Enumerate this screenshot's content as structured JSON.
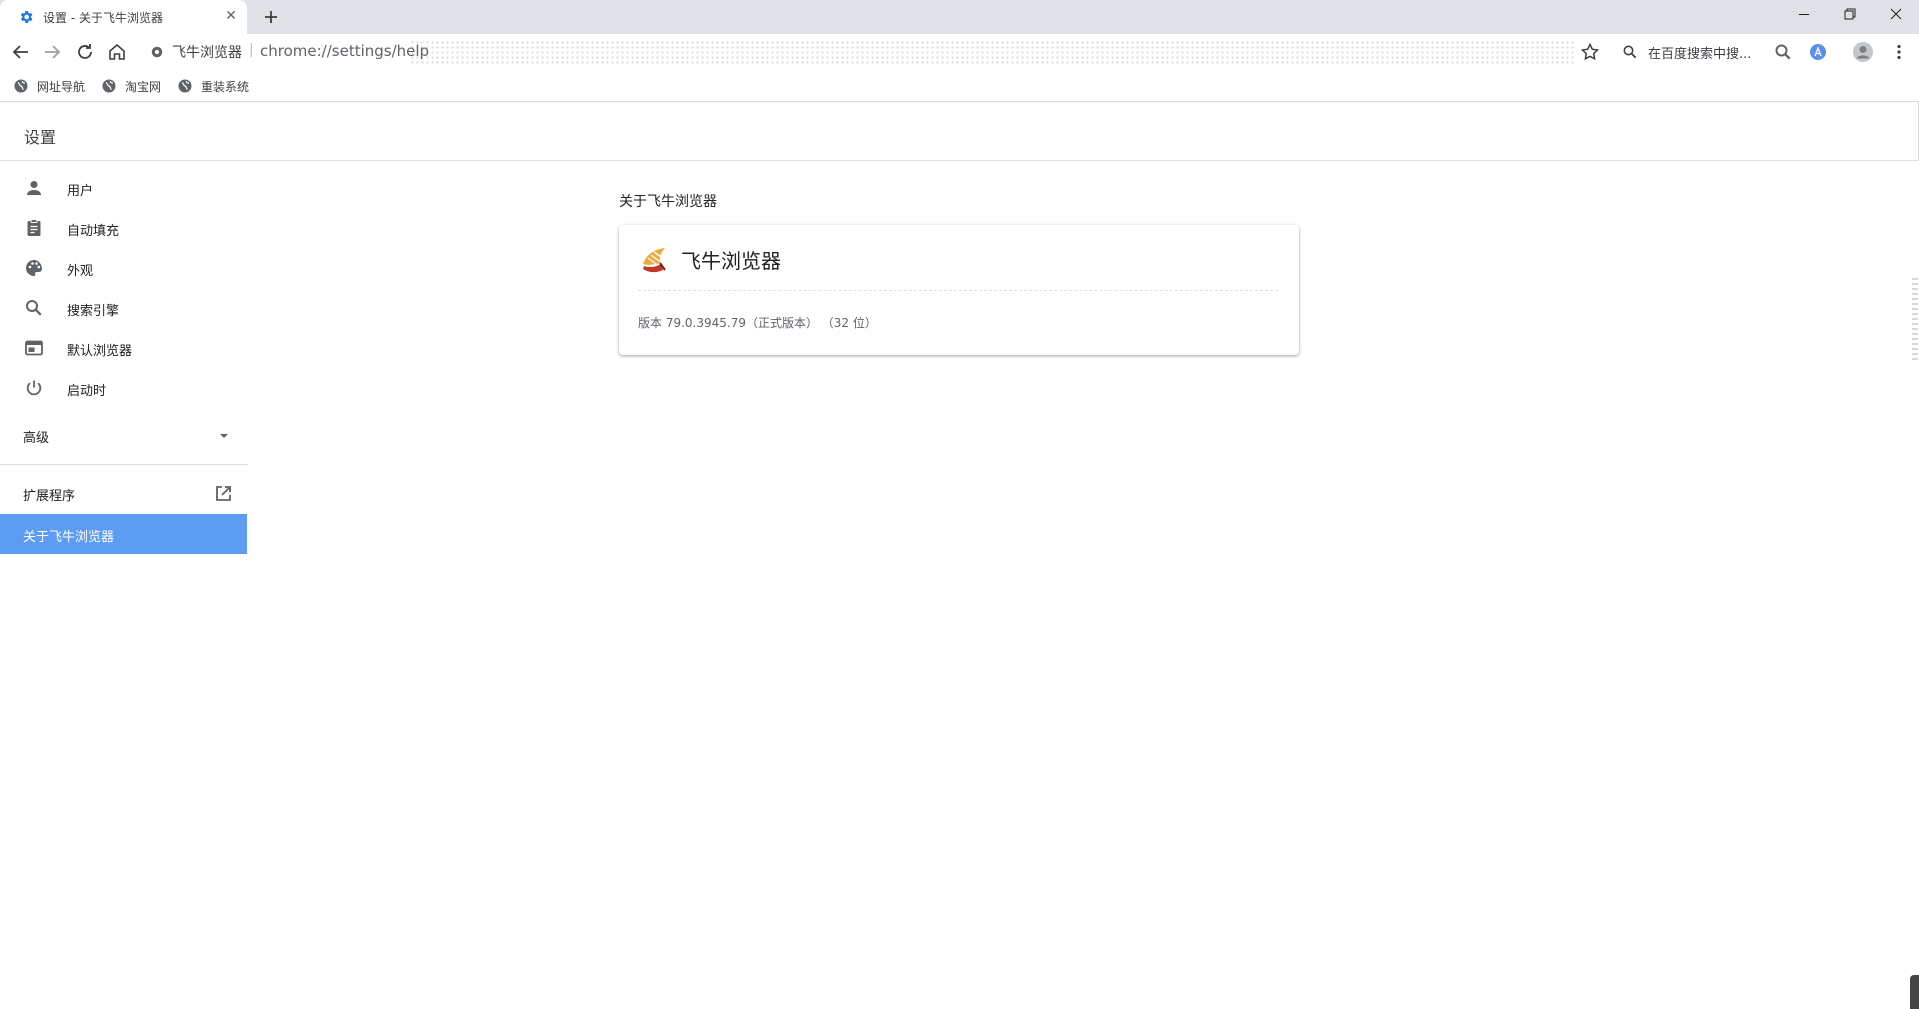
{
  "browser": {
    "tab": {
      "title": "设置 - 关于飞牛浏览器",
      "close": "✕"
    },
    "omnibox": {
      "site_name": "飞牛浏览器",
      "separator": "|",
      "url": "chrome://settings/help"
    },
    "search": {
      "text": "在百度搜索中搜..."
    },
    "bookmarks": [
      {
        "label": "网址导航"
      },
      {
        "label": "淘宝网"
      },
      {
        "label": "重装系统"
      }
    ]
  },
  "settings": {
    "header_title": "设置",
    "nav": [
      {
        "label": "用户",
        "icon": "person-icon"
      },
      {
        "label": "自动填充",
        "icon": "clipboard-icon"
      },
      {
        "label": "外观",
        "icon": "palette-icon"
      },
      {
        "label": "搜索引擎",
        "icon": "search-icon"
      },
      {
        "label": "默认浏览器",
        "icon": "browser-window-icon"
      },
      {
        "label": "启动时",
        "icon": "power-icon"
      }
    ],
    "advanced_label": "高级",
    "extensions_label": "扩展程序",
    "about_label": "关于飞牛浏览器",
    "active_color": "#5c9cf2"
  },
  "about": {
    "section_title": "关于飞牛浏览器",
    "product_name": "飞牛浏览器",
    "version": "版本 79.0.3945.79（正式版本） （32 位）"
  }
}
